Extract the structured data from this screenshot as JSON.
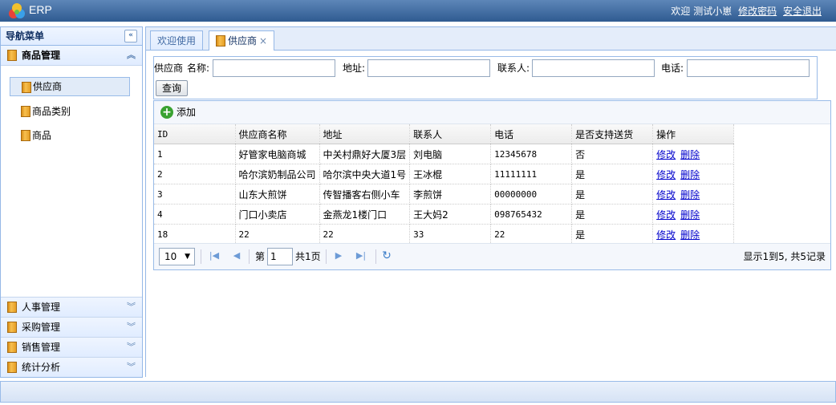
{
  "header": {
    "app_title": "ERP",
    "welcome": "欢迎",
    "user": "测试小崽",
    "change_password": "修改密码",
    "logout": "安全退出"
  },
  "sidebar": {
    "title": "导航菜单",
    "groups": [
      {
        "label": "商品管理",
        "expanded": true,
        "items": [
          {
            "label": "供应商",
            "selected": true
          },
          {
            "label": "商品类别"
          },
          {
            "label": "商品"
          }
        ]
      },
      {
        "label": "人事管理"
      },
      {
        "label": "采购管理"
      },
      {
        "label": "销售管理"
      },
      {
        "label": "统计分析"
      }
    ]
  },
  "tabs": [
    {
      "label": "欢迎使用",
      "active": false
    },
    {
      "label": "供应商",
      "active": true,
      "close": "×"
    }
  ],
  "search": {
    "prefix": "供应商",
    "name_label": "名称:",
    "address_label": "地址:",
    "contact_label": "联系人:",
    "phone_label": "电话:",
    "query_button": "查询"
  },
  "toolbar": {
    "add_label": "添加"
  },
  "grid": {
    "columns": [
      "ID",
      "供应商名称",
      "地址",
      "联系人",
      "电话",
      "是否支持送货",
      "操作"
    ],
    "rows": [
      [
        "1",
        "好管家电脑商城",
        "中关村鼎好大厦3层",
        "刘电脑",
        "12345678",
        "否"
      ],
      [
        "2",
        "哈尔滨奶制品公司",
        "哈尔滨中央大道1号",
        "王冰棍",
        "11111111",
        "是"
      ],
      [
        "3",
        "山东大煎饼",
        "传智播客右侧小车",
        "李煎饼",
        "00000000",
        "是"
      ],
      [
        "4",
        "门口小卖店",
        "金燕龙1楼门口",
        "王大妈2",
        "098765432",
        "是"
      ],
      [
        "18",
        "22",
        "22",
        "33",
        "22",
        "是"
      ]
    ],
    "edit_label": "修改",
    "delete_label": "删除"
  },
  "pager": {
    "page_size": "10",
    "page_prefix": "第",
    "page_number": "1",
    "page_total": "共1页",
    "info": "显示1到5, 共5记录"
  },
  "colors": {
    "accent": "#95b8e7",
    "header_bg": "#2f5b91",
    "link": "#0000cc"
  }
}
